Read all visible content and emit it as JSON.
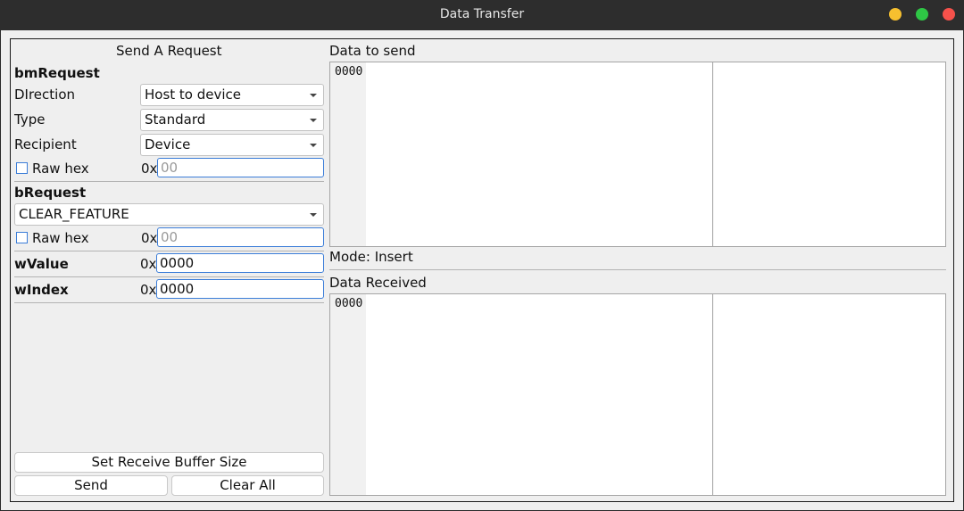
{
  "window": {
    "title": "Data Transfer"
  },
  "request_panel": {
    "heading": "Send A Request",
    "bmRequest": {
      "heading": "bmRequest",
      "direction_label": "DIrection",
      "direction_value": "Host to device",
      "type_label": "Type",
      "type_value": "Standard",
      "recipient_label": "Recipient",
      "recipient_value": "Device",
      "raw_hex_label": "Raw hex",
      "hex_prefix": "0x",
      "raw_hex_placeholder": "00",
      "raw_hex_value": ""
    },
    "bRequest": {
      "heading": "bRequest",
      "value": "CLEAR_FEATURE",
      "raw_hex_label": "Raw hex",
      "hex_prefix": "0x",
      "raw_hex_placeholder": "00",
      "raw_hex_value": ""
    },
    "wValue": {
      "label": "wValue",
      "hex_prefix": "0x",
      "value": "0000"
    },
    "wIndex": {
      "label": "wIndex",
      "hex_prefix": "0x",
      "value": "0000"
    },
    "buttons": {
      "set_buffer": "Set Receive Buffer Size",
      "send": "Send",
      "clear_all": "Clear All"
    }
  },
  "data_to_send": {
    "heading": "Data to send",
    "offset": "0000",
    "mode_text": "Mode: Insert"
  },
  "data_received": {
    "heading": "Data Received",
    "offset": "0000"
  },
  "colors": {
    "titlebar": "#2d2d2d",
    "background": "#efefef",
    "accent": "#3b7dd8",
    "minimize": "#f6c02f",
    "maximize": "#2ec645",
    "close": "#f5514b"
  }
}
